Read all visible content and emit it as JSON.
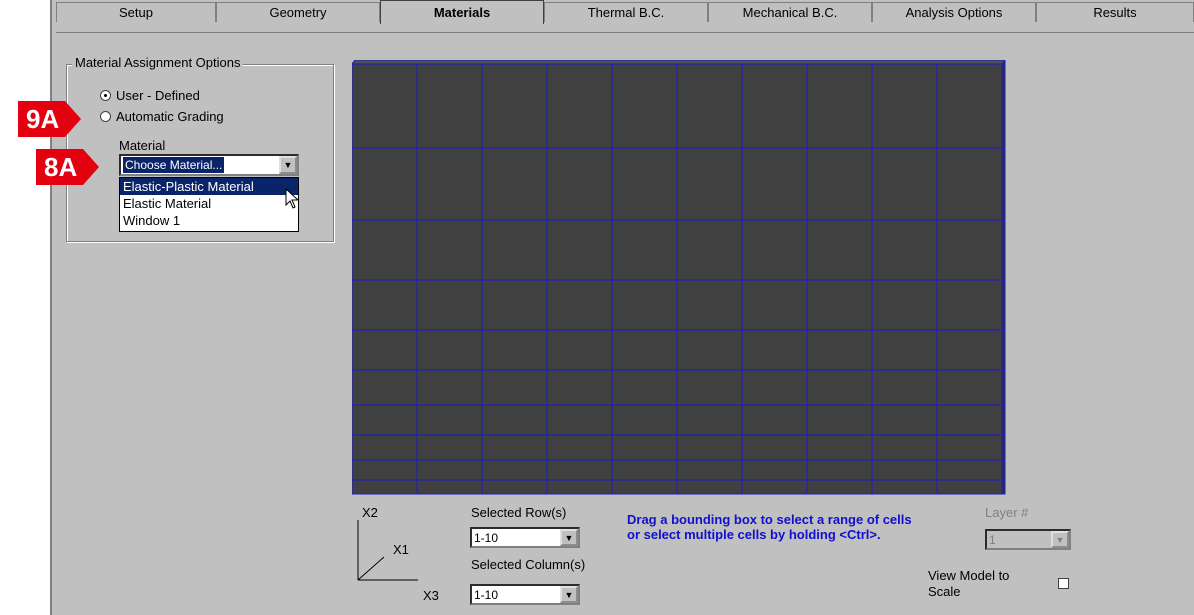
{
  "tabs": [
    "Setup",
    "Geometry",
    "Materials",
    "Thermal B.C.",
    "Mechanical B.C.",
    "Analysis Options",
    "Results"
  ],
  "active_tab": "Materials",
  "material_options": {
    "group_title": "Material Assignment Options",
    "radio_user_defined": "User - Defined",
    "radio_automatic": "Automatic Grading",
    "material_label": "Material",
    "material_value": "Choose Material...",
    "dropdown_options": [
      "Elastic-Plastic Material",
      "Elastic Material",
      "Window 1"
    ]
  },
  "annotations": {
    "badge_9a": "9A",
    "badge_8a": "8A"
  },
  "axes": {
    "x2": "X2",
    "x1": "X1",
    "x3": "X3"
  },
  "selection": {
    "rows_label": "Selected Row(s)",
    "rows_value": "1-10",
    "cols_label": "Selected Column(s)",
    "cols_value": "1-10"
  },
  "hint": "Drag a bounding box to select a range of cells or select multiple cells by holding <Ctrl>.",
  "layer": {
    "label": "Layer #",
    "value": "1"
  },
  "view_scale": {
    "label_1": "View Model to",
    "label_2": "Scale"
  },
  "colors": {
    "cell": "#404040",
    "grid_line": "#1a1acc",
    "selected_option": "#0a246a",
    "badge": "#e3000f"
  }
}
